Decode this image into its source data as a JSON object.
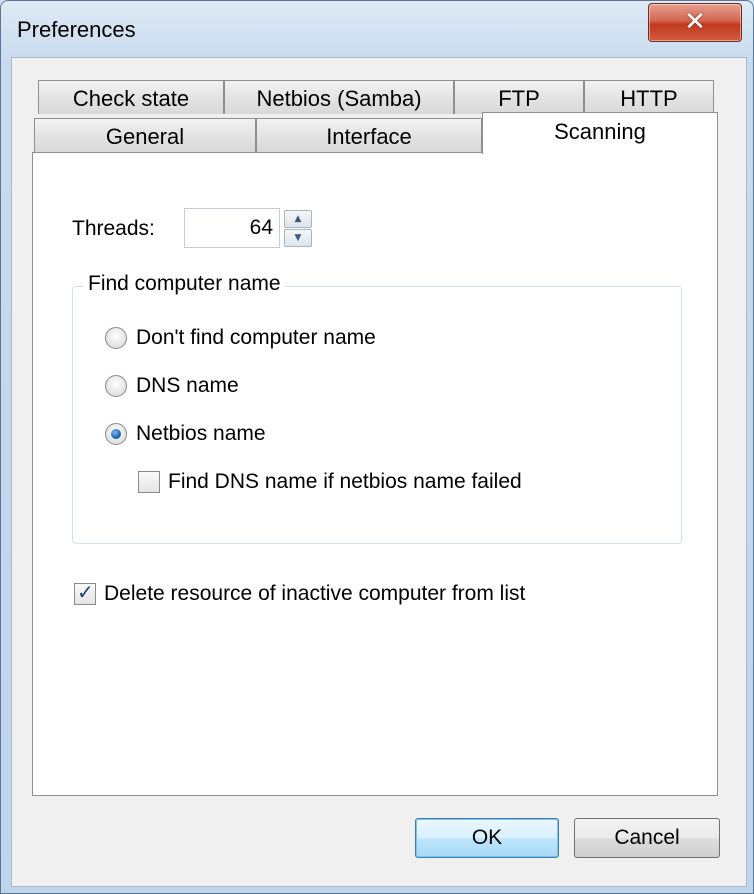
{
  "window": {
    "title": "Preferences",
    "close_glyph": "✕",
    "close_icon": "close-icon"
  },
  "tabs": {
    "row_back": [
      "Check state",
      "Netbios (Samba)",
      "FTP",
      "HTTP"
    ],
    "row_front": [
      "General",
      "Interface",
      "Scanning"
    ],
    "active": "Scanning"
  },
  "scanning": {
    "threads_label": "Threads:",
    "threads_value": "64",
    "spin_up_icon": "chevron-up-icon",
    "spin_down_icon": "chevron-down-icon",
    "spin_up_glyph": "▲",
    "spin_down_glyph": "▼",
    "group_title": "Find computer name",
    "options": [
      {
        "label": "Don't find computer name",
        "selected": false
      },
      {
        "label": "DNS name",
        "selected": false
      },
      {
        "label": "Netbios name",
        "selected": true
      }
    ],
    "fallback_dns_label": "Find DNS name if netbios name failed",
    "fallback_dns_checked": false,
    "delete_inactive_label": "Delete resource of inactive computer from list",
    "delete_inactive_checked": true,
    "check_glyph": "✓"
  },
  "buttons": {
    "ok": "OK",
    "cancel": "Cancel"
  }
}
